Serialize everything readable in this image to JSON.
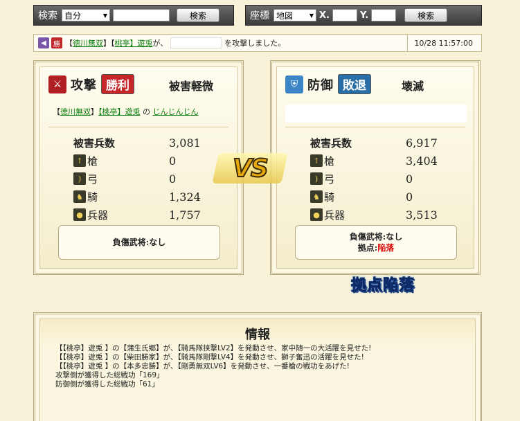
{
  "search": {
    "label": "検索",
    "select_value": "自分",
    "button": "検索"
  },
  "coord": {
    "label": "座標",
    "select_value": "地図",
    "x_label": "X.",
    "y_label": "Y.",
    "button": "検索"
  },
  "log": {
    "text_a": "【",
    "attacker_alliance": "徳川無双",
    "text_b": "】【",
    "attacker_name": "桃亭】遊兎",
    "text_c": "が、",
    "text_d": "を攻撃しました。",
    "time": "10/28 11:57:00",
    "badge": "勝"
  },
  "attack": {
    "title": "攻撃",
    "result": "勝利",
    "damage": "被害軽微",
    "name_prefix": "【",
    "alliance": "徳川無双",
    "name_mid": "】",
    "player": "【桃亭】遊兎",
    "name_no": "の",
    "village": "じんじんじん",
    "stats": [
      {
        "label": "被害兵数",
        "value": "3,081"
      },
      {
        "label": "槍",
        "value": "0"
      },
      {
        "label": "弓",
        "value": "0"
      },
      {
        "label": "騎",
        "value": "1,324"
      },
      {
        "label": "兵器",
        "value": "1,757"
      }
    ],
    "note_line1": "負傷武将:なし"
  },
  "defense": {
    "title": "防御",
    "result": "敗退",
    "damage": "壊滅",
    "stats": [
      {
        "label": "被害兵数",
        "value": "6,917"
      },
      {
        "label": "槍",
        "value": "3,404"
      },
      {
        "label": "弓",
        "value": "0"
      },
      {
        "label": "騎",
        "value": "0"
      },
      {
        "label": "兵器",
        "value": "3,513"
      }
    ],
    "note_line1": "負傷武将:なし",
    "note_line2_label": "拠点:",
    "note_line2_value": "陥落"
  },
  "vs": "VS",
  "stronghold_fallen": "拠点陥落",
  "info": {
    "title": "情報",
    "lines": [
      "【【桃亭】遊兎 】の【蒲生氏郷】が、【騎馬隊挟撃LV2】を発動させ、家中随一の大活躍を見せた!",
      "【【桃亭】遊兎 】の【柴田勝家】が、【騎馬隊剛撃LV4】を発動させ、獅子奮迅の活躍を見せた!",
      "【【桃亭】遊兎 】の【本多忠勝】が、【剛勇無双LV6】を発動させ、一番槍の戦功をあげた!",
      "攻撃側が獲得した総戦功「169」",
      "防御側が獲得した総戦功「61」"
    ]
  },
  "colors": {
    "win": "#c4262a",
    "lose": "#2a6ea8",
    "fallen": "#dd1111",
    "link": "#0a7d0a"
  }
}
